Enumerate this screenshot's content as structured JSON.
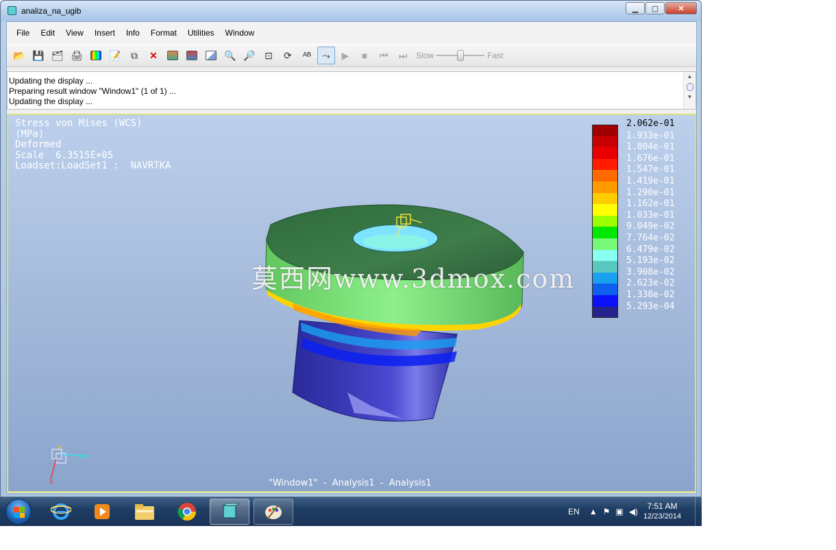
{
  "window": {
    "title": "analiza_na_ugib",
    "minimize": "▁",
    "maximize": "▢",
    "close": "✕"
  },
  "menu": [
    "File",
    "Edit",
    "View",
    "Insert",
    "Info",
    "Format",
    "Utilities",
    "Window"
  ],
  "toolbar": {
    "icons": [
      "open-icon",
      "save-icon",
      "save-as-icon",
      "print-icon",
      "color-edit-icon",
      "definition-icon",
      "copy-icon",
      "delete-icon",
      "show-icon",
      "hide-icon",
      "edit-view-icon",
      "zoom-in-icon",
      "zoom-out-icon",
      "refit-icon",
      "spin-icon",
      "label-icon",
      "query-icon"
    ],
    "playback": [
      "play-icon",
      "stop-icon",
      "first-frame-icon",
      "last-frame-icon"
    ],
    "slow_label": "Slow",
    "fast_label": "Fast",
    "speed_fraction": 0.5
  },
  "messages": [
    "Updating the display ...",
    "Preparing result window \"Window1\" (1 of 1) ...",
    "Updating the display ..."
  ],
  "viewport": {
    "info_lines": [
      "Stress von Mises (WCS)",
      "(MPa)",
      "Deformed",
      "Scale  6.3515E+05",
      "Loadset:LoadSet1 :  NAVRTKA"
    ],
    "legend": [
      {
        "value": "2.062e-01",
        "color": "#a00000"
      },
      {
        "value": "1.933e-01",
        "color": "#c80000"
      },
      {
        "value": "1.804e-01",
        "color": "#e80000"
      },
      {
        "value": "1.676e-01",
        "color": "#ff1a00"
      },
      {
        "value": "1.547e-01",
        "color": "#ff6a00"
      },
      {
        "value": "1.419e-01",
        "color": "#ff9a00"
      },
      {
        "value": "1.290e-01",
        "color": "#ffcc00"
      },
      {
        "value": "1.162e-01",
        "color": "#ffff00"
      },
      {
        "value": "1.033e-01",
        "color": "#9cff00"
      },
      {
        "value": "9.049e-02",
        "color": "#00e800"
      },
      {
        "value": "7.764e-02",
        "color": "#78f878"
      },
      {
        "value": "6.479e-02",
        "color": "#88fff0"
      },
      {
        "value": "5.193e-02",
        "color": "#58c8c0"
      },
      {
        "value": "3.908e-02",
        "color": "#1aa0f0"
      },
      {
        "value": "2.623e-02",
        "color": "#1060f0"
      },
      {
        "value": "1.338e-02",
        "color": "#0a10f8"
      },
      {
        "value": "5.293e-04",
        "color": "#24248c"
      }
    ],
    "watermark": "莫西网www.3dmox.com",
    "footer": "\"Window1\"  -  Analysis1  -  Analysis1",
    "triad_labels": {
      "x": "x",
      "y": "y",
      "z": "z"
    }
  },
  "taskbar": {
    "apps": [
      "internet-explorer-icon",
      "media-player-icon",
      "file-explorer-icon",
      "chrome-icon",
      "creo-simulate-icon",
      "paint-icon"
    ],
    "language": "EN",
    "time": "7:51 AM",
    "date": "12/23/2014"
  }
}
